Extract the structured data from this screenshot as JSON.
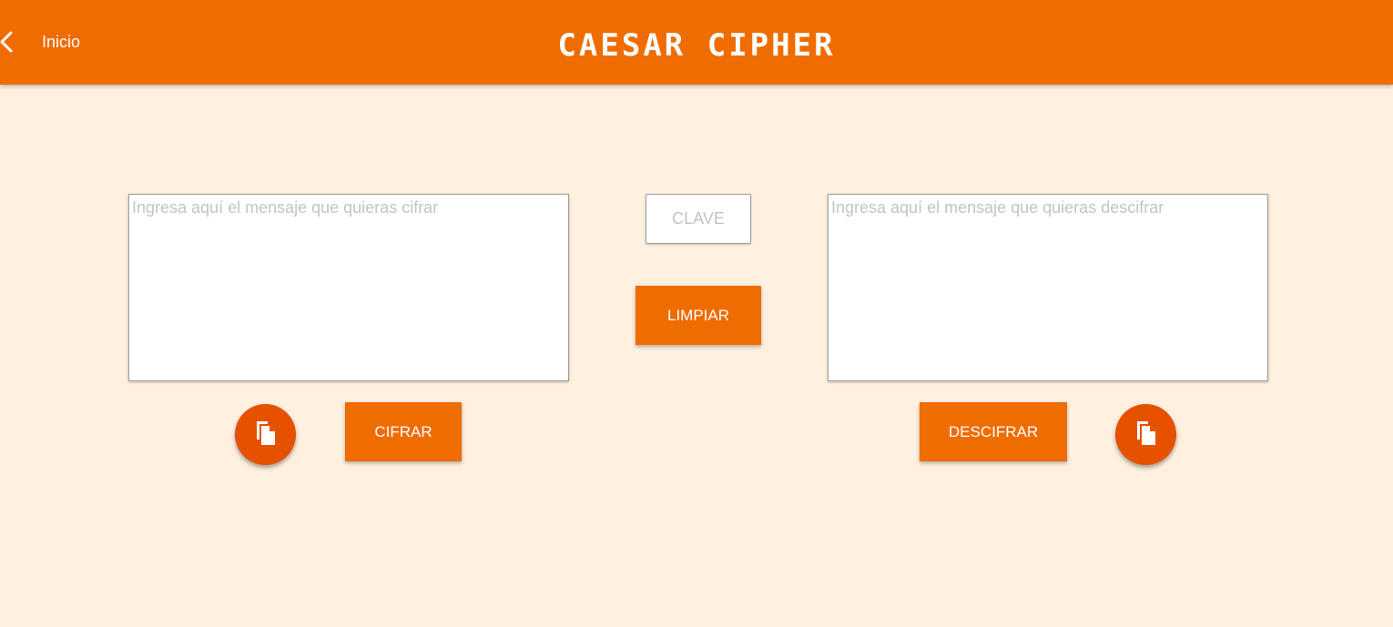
{
  "header": {
    "back_label": "Inicio",
    "title": "CAESAR CIPHER",
    "background_color": "#ef6c00"
  },
  "encrypt_panel": {
    "input_placeholder": "Ingresa aquí el mensaje que quieras cifrar",
    "input_value": "",
    "copy_icon": "copy-icon",
    "action_label": "CIFRAR"
  },
  "key": {
    "placeholder": "CLAVE",
    "value": "",
    "clear_label": "LIMPIAR"
  },
  "decrypt_panel": {
    "input_placeholder": "Ingresa aquí el mensaje que quieras descifrar",
    "input_value": "",
    "copy_icon": "copy-icon",
    "action_label": "DESCIFRAR"
  },
  "colors": {
    "accent": "#ef6c00",
    "fab": "#e65100",
    "page_background": "#fff0df"
  }
}
